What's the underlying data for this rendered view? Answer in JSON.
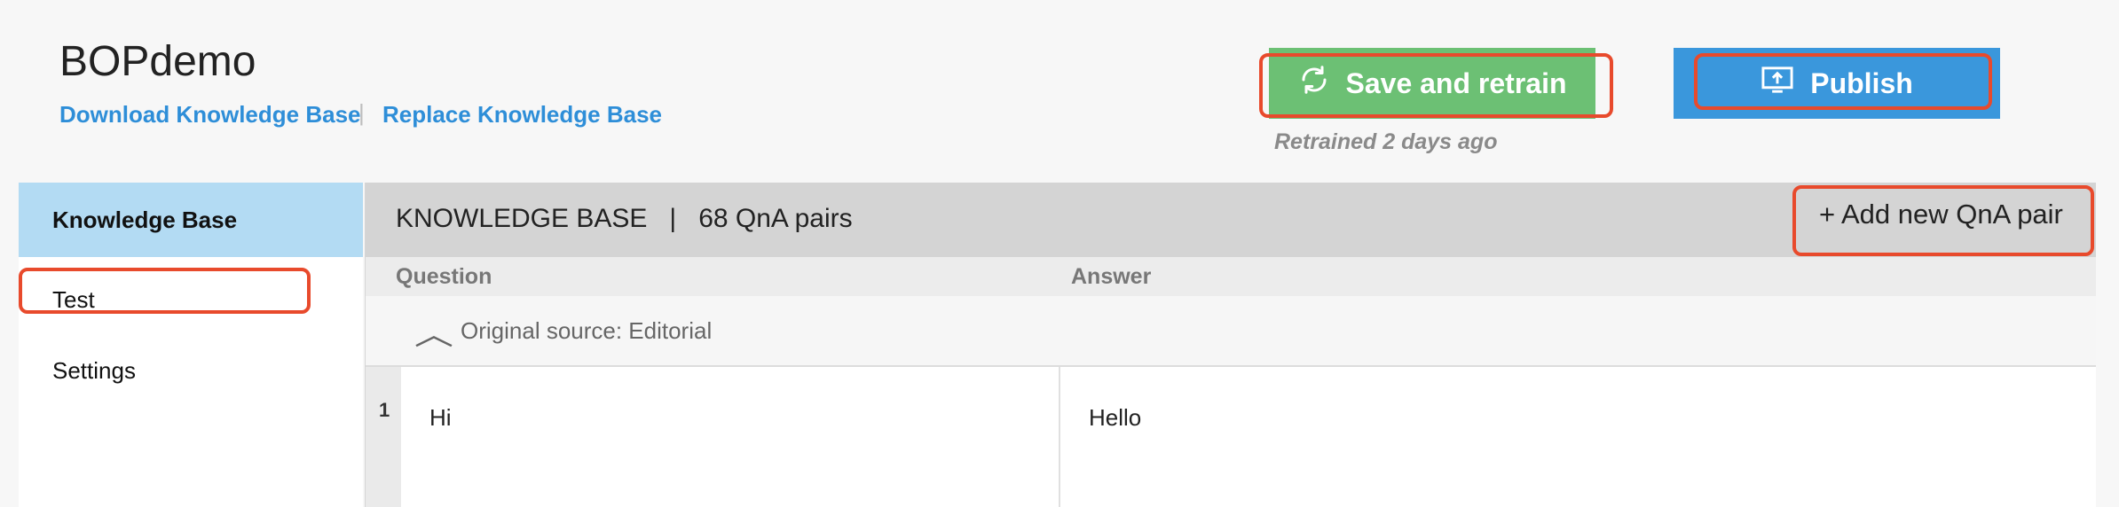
{
  "header": {
    "kb_name": "BOPdemo",
    "download_link": "Download Knowledge Base",
    "separator": "|",
    "replace_link": "Replace Knowledge Base",
    "save_button": "Save and retrain",
    "save_icon": "refresh-icon",
    "publish_button": "Publish",
    "publish_icon": "upload-icon",
    "retrained_status": "Retrained 2 days ago"
  },
  "sidebar": {
    "items": [
      {
        "label": "Knowledge Base",
        "active": true
      },
      {
        "label": "Test",
        "active": false
      },
      {
        "label": "Settings",
        "active": false
      }
    ]
  },
  "main": {
    "title": "KNOWLEDGE BASE   |   68 QnA pairs",
    "add_button": "+ Add new QnA pair",
    "columns": {
      "question": "Question",
      "answer": "Answer"
    },
    "source_label": "Original source: Editorial",
    "rows": [
      {
        "number": "1",
        "question": "Hi",
        "answer": "Hello"
      }
    ]
  },
  "colors": {
    "save": "#6cc074",
    "publish": "#3a97dc",
    "active_nav": "#b3dbf3",
    "highlight_box": "#e84a2c",
    "link": "#2e8ed8"
  }
}
